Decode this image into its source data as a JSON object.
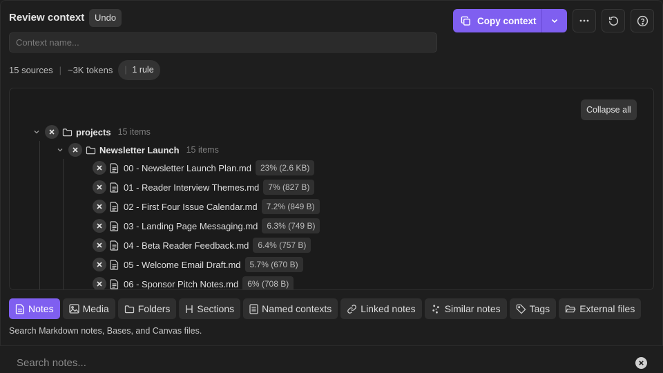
{
  "header": {
    "title": "Review context",
    "undo_label": "Undo",
    "copy_label": "Copy context",
    "context_placeholder": "Context name..."
  },
  "stats": {
    "sources": "15 sources",
    "separator": "|",
    "tokens": "~3K tokens",
    "rules": "1 rule"
  },
  "tree": {
    "collapse_label": "Collapse all",
    "root": {
      "name": "projects",
      "count": "15 items"
    },
    "sub": {
      "name": "Newsletter Launch",
      "count": "15 items"
    },
    "files": [
      {
        "name": "00 - Newsletter Launch Plan.md",
        "size": "23% (2.6 KB)"
      },
      {
        "name": "01 - Reader Interview Themes.md",
        "size": "7% (827 B)"
      },
      {
        "name": "02 - First Four Issue Calendar.md",
        "size": "7.2% (849 B)"
      },
      {
        "name": "03 - Landing Page Messaging.md",
        "size": "6.3% (749 B)"
      },
      {
        "name": "04 - Beta Reader Feedback.md",
        "size": "6.4% (757 B)"
      },
      {
        "name": "05 - Welcome Email Draft.md",
        "size": "5.7% (670 B)"
      },
      {
        "name": "06 - Sponsor Pitch Notes.md",
        "size": "6% (708 B)"
      }
    ]
  },
  "tabs": [
    {
      "label": "Notes",
      "icon": "note-icon",
      "active": true
    },
    {
      "label": "Media",
      "icon": "image-icon"
    },
    {
      "label": "Folders",
      "icon": "folder-icon"
    },
    {
      "label": "Sections",
      "icon": "heading-icon"
    },
    {
      "label": "Named contexts",
      "icon": "list-icon"
    },
    {
      "label": "Linked notes",
      "icon": "link-icon"
    },
    {
      "label": "Similar notes",
      "icon": "sparkle-icon"
    },
    {
      "label": "Tags",
      "icon": "tag-icon"
    },
    {
      "label": "External files",
      "icon": "folder-open-icon"
    }
  ],
  "description": "Search Markdown notes, Bases, and Canvas files.",
  "search": {
    "placeholder": "Search notes..."
  },
  "colors": {
    "accent": "#7f5ff0",
    "background": "#1e1e1e",
    "panel": "#1b1b1b"
  }
}
